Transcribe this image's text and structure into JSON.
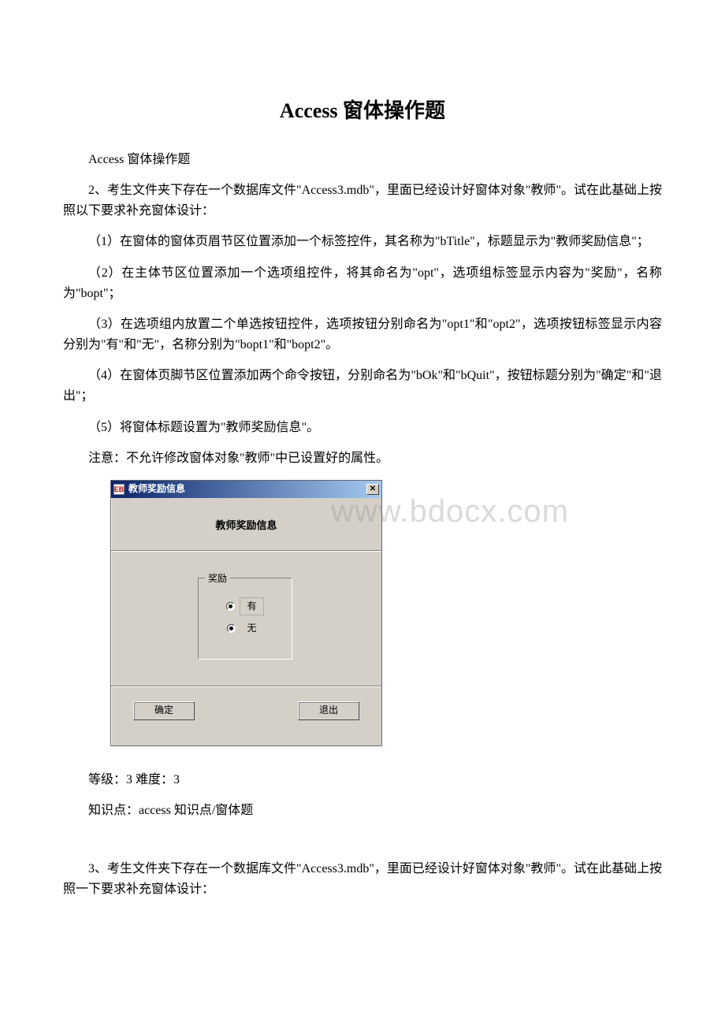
{
  "title": "Access 窗体操作题",
  "subtitle": "Access 窗体操作题",
  "q2": {
    "intro": "2、考生文件夹下存在一个数据库文件\"Access3.mdb\"，里面已经设计好窗体对象\"教师\"。试在此基础上按照以下要求补充窗体设计：",
    "item1": "（1）在窗体的窗体页眉节区位置添加一个标签控件，其名称为\"bTitle\"，标题显示为\"教师奖励信息\"；",
    "item2": "（2）在主体节区位置添加一个选项组控件，将其命名为\"opt\"，选项组标签显示内容为\"奖励\"，名称为\"bopt\"；",
    "item3": "（3）在选项组内放置二个单选按钮控件，选项按钮分别命名为\"opt1\"和\"opt2\"，选项按钮标签显示内容分别为\"有\"和\"无\"，名称分别为\"bopt1\"和\"bopt2\"。",
    "item4": "（4）在窗体页脚节区位置添加两个命令按钮，分别命名为\"bOk\"和\"bQuit\"，按钮标题分别为\"确定\"和\"退出\"；",
    "item5": "（5）将窗体标题设置为\"教师奖励信息\"。",
    "note": "注意：不允许修改窗体对象\"教师\"中已设置好的属性。"
  },
  "form": {
    "titlebar": "教师奖励信息",
    "header_label": "教师奖励信息",
    "frame_caption": "奖励",
    "radio1": "有",
    "radio2": "无",
    "btn_ok": "确定",
    "btn_quit": "退出"
  },
  "watermark": "www.bdocx.com",
  "meta": {
    "level": "等级：3 难度：3",
    "kp": "知识点：access 知识点/窗体题"
  },
  "q3": {
    "intro": "3、考生文件夹下存在一个数据库文件\"Access3.mdb\"，里面已经设计好窗体对象\"教师\"。试在此基础上按照一下要求补充窗体设计："
  }
}
